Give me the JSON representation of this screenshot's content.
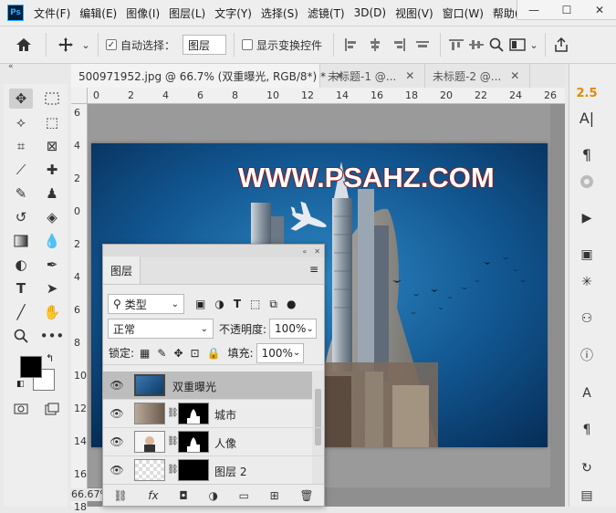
{
  "menubar": {
    "logo": "Ps",
    "items": [
      "文件(F)",
      "编辑(E)",
      "图像(I)",
      "图层(L)",
      "文字(Y)",
      "选择(S)",
      "滤镜(T)",
      "3D(D)",
      "视图(V)",
      "窗口(W)",
      "帮助("
    ],
    "window_buttons": [
      "minimize",
      "maximize",
      "close"
    ]
  },
  "options": {
    "auto_select_label": "自动选择：",
    "auto_select_checked": true,
    "auto_select_value": "图层",
    "show_transform_label": "显示变换控件",
    "show_transform_checked": false
  },
  "tabs": [
    {
      "label": "500971952.jpg @ 66.7% (双重曝光, RGB/8*) *",
      "active": true
    },
    {
      "label": "未标题-1 @...",
      "active": false
    },
    {
      "label": "未标题-2 @...",
      "active": false
    }
  ],
  "ruler_h": [
    "0",
    "2",
    "4",
    "6",
    "8",
    "10",
    "12",
    "14",
    "16",
    "18",
    "20",
    "22",
    "24",
    "26"
  ],
  "ruler_v": [
    "6",
    "4",
    "2",
    "0",
    "2",
    "4",
    "6",
    "8",
    "10",
    "12",
    "14",
    "16",
    "18"
  ],
  "zoom": "66.67%",
  "canvas": {
    "watermark": "WWW.PSAHZ.COM"
  },
  "right_panel": {
    "version_label": "2.5"
  },
  "layers_panel": {
    "tab": "图层",
    "filter_kind": "类型",
    "blend_mode": "正常",
    "opacity_label": "不透明度:",
    "opacity_value": "100%",
    "lock_label": "锁定:",
    "fill_label": "填充:",
    "fill_value": "100%",
    "layers": [
      {
        "name": "双重曝光",
        "selected": true
      },
      {
        "name": "城市",
        "selected": false
      },
      {
        "name": "人像",
        "selected": false
      },
      {
        "name": "图层 2",
        "selected": false
      }
    ]
  },
  "colors": {
    "accent": "#31a8ff",
    "watermark": "#ffffff",
    "watermark_stroke": "#8b1a1a",
    "sky": "#0d4a80"
  }
}
